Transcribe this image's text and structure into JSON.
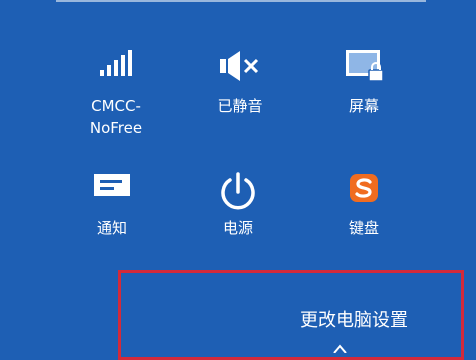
{
  "panel": {
    "background_color": "#1e5fb4",
    "tiles": [
      {
        "label": "CMCC-\nNoFree",
        "icon": "wifi-signal-icon"
      },
      {
        "label": "已静音",
        "icon": "speaker-muted-icon"
      },
      {
        "label": "屏幕",
        "icon": "screen-brightness-lock-icon"
      },
      {
        "label": "通知",
        "icon": "notification-icon"
      },
      {
        "label": "电源",
        "icon": "power-icon"
      },
      {
        "label": "键盘",
        "icon": "sogou-keyboard-icon"
      }
    ],
    "change_pc_settings": "更改电脑设置",
    "highlight_color": "#d32a3a"
  }
}
